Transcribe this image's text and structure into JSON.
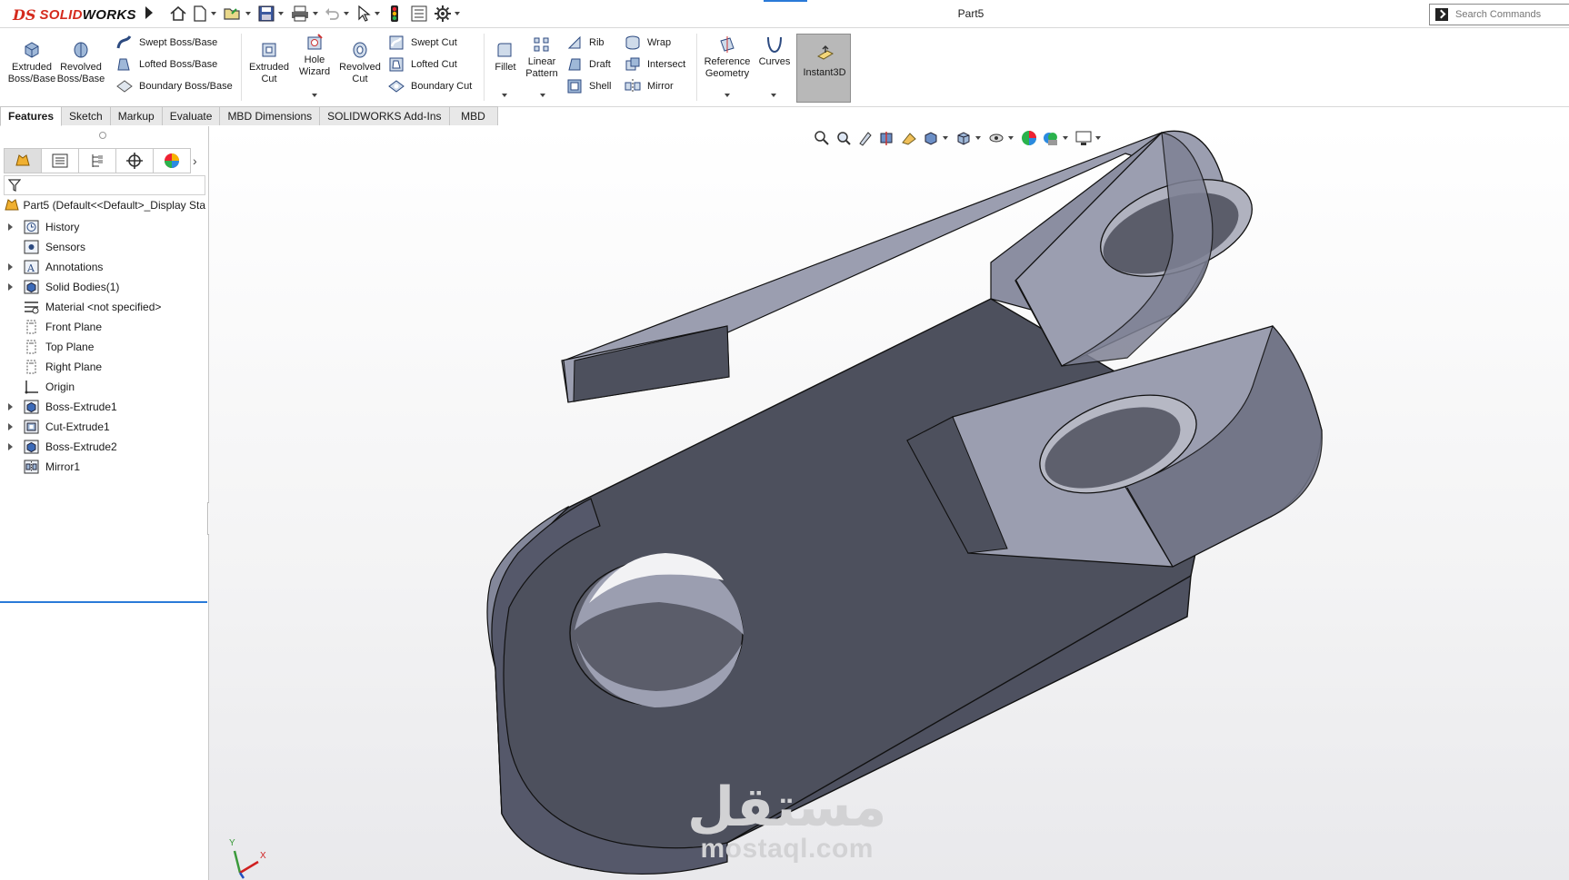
{
  "app": {
    "logo_ds": "DS",
    "logo_solid": "SOLID",
    "logo_works": "WORKS",
    "doc_title": "Part5",
    "search_placeholder": "Search Commands"
  },
  "command_manager": {
    "extruded_boss": "Extruded\nBoss/Base",
    "revolved_boss": "Revolved\nBoss/Base",
    "swept_boss": "Swept Boss/Base",
    "lofted_boss": "Lofted Boss/Base",
    "boundary_boss": "Boundary Boss/Base",
    "extruded_cut": "Extruded\nCut",
    "hole_wizard": "Hole\nWizard",
    "revolved_cut": "Revolved\nCut",
    "swept_cut": "Swept Cut",
    "lofted_cut": "Lofted Cut",
    "boundary_cut": "Boundary Cut",
    "fillet": "Fillet",
    "linear_pattern": "Linear\nPattern",
    "rib": "Rib",
    "draft": "Draft",
    "shell": "Shell",
    "wrap": "Wrap",
    "intersect": "Intersect",
    "mirror": "Mirror",
    "reference_geometry": "Reference\nGeometry",
    "curves": "Curves",
    "instant3d": "Instant3D"
  },
  "tabs": [
    "Features",
    "Sketch",
    "Markup",
    "Evaluate",
    "MBD Dimensions",
    "SOLIDWORKS Add-Ins",
    "MBD"
  ],
  "active_tab": "Features",
  "feature_tree": {
    "root": "Part5  (Default<<Default>_Display Sta",
    "items": [
      {
        "label": "History",
        "expandable": true,
        "icon": "history-icon"
      },
      {
        "label": "Sensors",
        "expandable": false,
        "icon": "sensors-icon"
      },
      {
        "label": "Annotations",
        "expandable": true,
        "icon": "annotations-icon"
      },
      {
        "label": "Solid Bodies(1)",
        "expandable": true,
        "icon": "solid-bodies-icon"
      },
      {
        "label": "Material <not specified>",
        "expandable": false,
        "icon": "material-icon"
      },
      {
        "label": "Front Plane",
        "expandable": false,
        "icon": "plane-icon"
      },
      {
        "label": "Top Plane",
        "expandable": false,
        "icon": "plane-icon"
      },
      {
        "label": "Right Plane",
        "expandable": false,
        "icon": "plane-icon"
      },
      {
        "label": "Origin",
        "expandable": false,
        "icon": "origin-icon"
      },
      {
        "label": "Boss-Extrude1",
        "expandable": true,
        "icon": "boss-extrude-icon"
      },
      {
        "label": "Cut-Extrude1",
        "expandable": true,
        "icon": "cut-extrude-icon"
      },
      {
        "label": "Boss-Extrude2",
        "expandable": true,
        "icon": "boss-extrude-icon"
      },
      {
        "label": "Mirror1",
        "expandable": false,
        "icon": "mirror-feature-icon"
      }
    ]
  },
  "triad": {
    "x": "X",
    "y": "Y"
  },
  "watermark": {
    "arabic": "مستقل",
    "latin": "mostaql.com"
  },
  "colors": {
    "accent": "#2a7ad8",
    "brand": "#d52b1e",
    "model_top": "#9b9eb0",
    "model_side": "#4d505d"
  }
}
